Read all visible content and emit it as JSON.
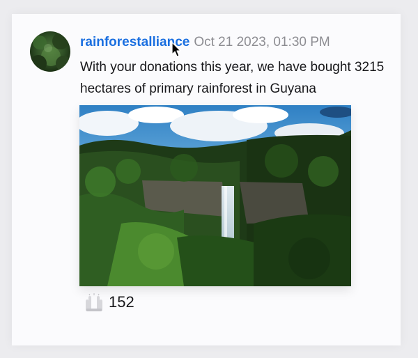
{
  "post": {
    "username": "rainforestalliance",
    "timestamp": "Oct 21 2023, 01:30 PM",
    "text": "With your donations this year, we have bought 3215 hectares of primary rainforest in Guyana",
    "image_icon": "waterfall-rainforest-photo",
    "reaction": {
      "icon": "raised-hands-icon",
      "count": "152"
    }
  },
  "colors": {
    "username": "#1a6fe0",
    "timestamp": "#8d8d92",
    "text": "#17171a",
    "card_background": "#fbfbfd",
    "page_background": "#ececef"
  }
}
